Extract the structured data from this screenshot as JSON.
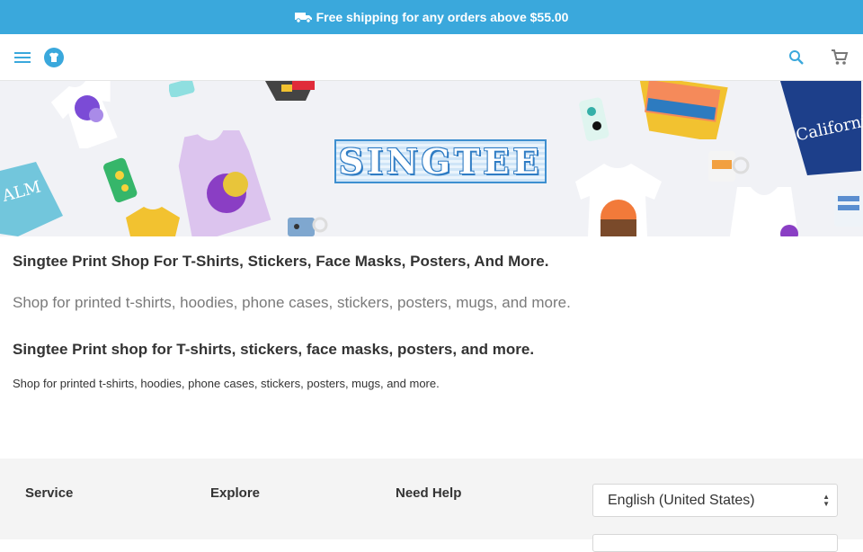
{
  "announcement": {
    "text": "Free shipping for any orders above $55.00",
    "icon": "truck-icon"
  },
  "header": {
    "menu_icon": "menu-icon",
    "logo_icon": "tshirt-logo-icon",
    "search_icon": "search-icon",
    "cart_icon": "cart-icon"
  },
  "banner": {
    "logo_text": "SINGTEE"
  },
  "content": {
    "heading": "Singtee Print Shop For T-Shirts, Stickers, Face Masks, Posters, And More.",
    "lead": "Shop for printed t-shirts, hoodies, phone cases, stickers, posters, mugs, and more.",
    "heading2": "Singtee Print shop for T-shirts, stickers, face masks, posters, and more.",
    "body": "Shop for printed t-shirts, hoodies, phone cases, stickers, posters, mugs, and more."
  },
  "footer": {
    "columns": [
      "Service",
      "Explore",
      "Need Help"
    ],
    "language_select": {
      "value": "English (United States)"
    }
  },
  "colors": {
    "accent": "#3aa8dc",
    "footer_bg": "#f4f4f4",
    "banner_bg": "#f1f2f6"
  }
}
